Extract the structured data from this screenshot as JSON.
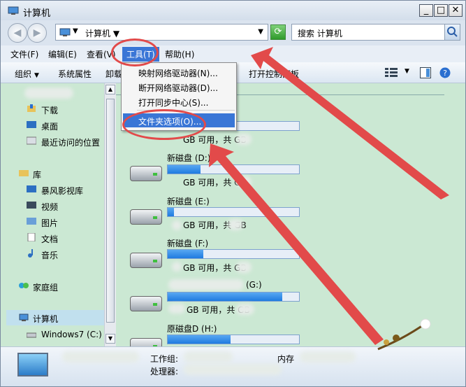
{
  "window": {
    "title": "计算机"
  },
  "address": {
    "path": "计算机",
    "search_placeholder": "搜索 计算机"
  },
  "menubar": {
    "items": [
      "文件(F)",
      "编辑(E)",
      "查看(V)",
      "工具(T)",
      "帮助(H)"
    ]
  },
  "toolbar": {
    "organize": "组织",
    "system_properties": "系统属性",
    "uninstall": "卸载",
    "control_panel": "打开控制面板"
  },
  "tools_menu": {
    "items": [
      "映射网络驱动器(N)...",
      "断开网络驱动器(D)...",
      "打开同步中心(S)...",
      "文件夹选项(O)..."
    ]
  },
  "navpane": {
    "favorites": [
      "下载",
      "桌面",
      "最近访问的位置"
    ],
    "library_title": "库",
    "libraries": [
      "暴风影视库",
      "视频",
      "图片",
      "文档",
      "音乐"
    ],
    "homegroup": "家庭组",
    "computer": "计算机",
    "drive_c": "Windows7 (C:)"
  },
  "drives": [
    {
      "label": "",
      "info": "GB 可用，共        GB",
      "fill_percent": 0
    },
    {
      "label": "新磁盘 (D:)",
      "info": "GB 可用，共        GB",
      "fill_percent": 25
    },
    {
      "label": "新磁盘 (E:)",
      "info": "GB 可用，共        GB",
      "fill_percent": 5
    },
    {
      "label": "新磁盘 (F:)",
      "info": "GB 可用，共        GB",
      "fill_percent": 27
    },
    {
      "label": "(G:)",
      "info": "GB 可用，共        GB",
      "fill_percent": 87
    },
    {
      "label": "原磁盘D (H:)",
      "info": "",
      "fill_percent": 48
    }
  ],
  "details": {
    "workgroup_label": "工作组:",
    "memory_label": "内存",
    "processor_label": "处理器:"
  },
  "colors": {
    "accent": "#3a76d6",
    "annotation": "#e24a4a",
    "pane": "#cbe8d3"
  }
}
